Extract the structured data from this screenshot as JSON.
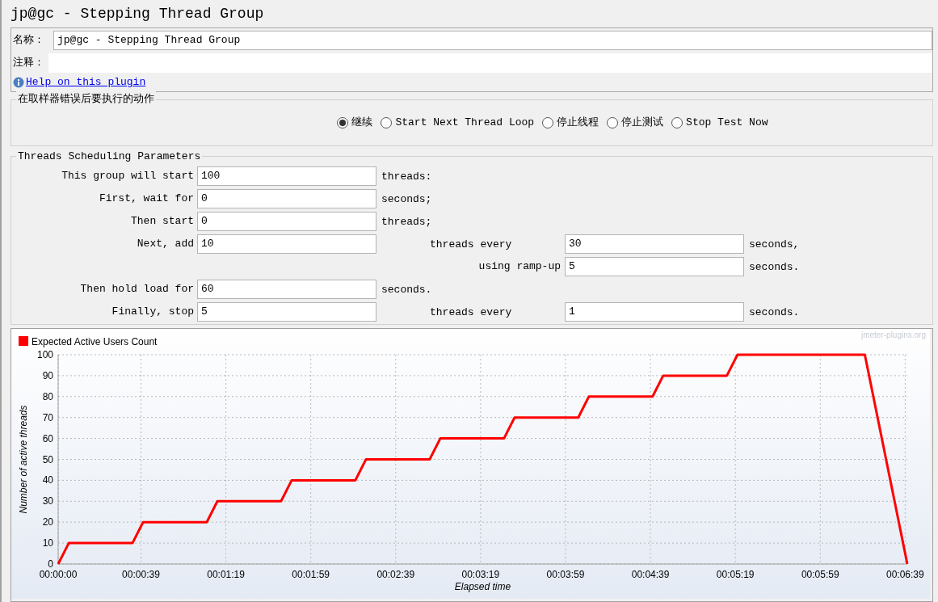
{
  "title": "jp@gc - Stepping Thread Group",
  "name_panel": {
    "name_label": "名称：",
    "name_value": "jp@gc - Stepping Thread Group",
    "comment_label": "注释：",
    "help_link": "Help on this plugin"
  },
  "error_action": {
    "title": "在取样器错误后要执行的动作",
    "options": [
      {
        "label": "继续",
        "selected": true
      },
      {
        "label": "Start Next Thread Loop",
        "selected": false
      },
      {
        "label": "停止线程",
        "selected": false
      },
      {
        "label": "停止测试",
        "selected": false
      },
      {
        "label": "Stop Test Now",
        "selected": false
      }
    ]
  },
  "scheduling": {
    "title": "Threads Scheduling Parameters",
    "rows": [
      {
        "kind": "single",
        "label": "This group will start",
        "value": "100",
        "unit": "threads:"
      },
      {
        "kind": "single",
        "label": "First, wait for",
        "value": "0",
        "unit": "seconds;"
      },
      {
        "kind": "single",
        "label": "Then start",
        "value": "0",
        "unit": "threads;"
      },
      {
        "kind": "dual",
        "label": "Next, add",
        "value": "10",
        "unit": "threads every",
        "value2": "30",
        "unit2": "seconds,"
      },
      {
        "kind": "secondary",
        "label": "using ramp-up",
        "value": "5",
        "unit": "seconds."
      },
      {
        "kind": "single",
        "label": "Then hold load for",
        "value": "60",
        "unit": "seconds."
      },
      {
        "kind": "dual",
        "label": "Finally, stop",
        "value": "5",
        "unit": "threads every",
        "value2": "1",
        "unit2": "seconds."
      }
    ]
  },
  "chart": {
    "credit": "jmeter-plugins.org",
    "chart_data": {
      "type": "line",
      "xlabel": "Elapsed time",
      "ylabel": "Number of active threads",
      "x": [
        0,
        5,
        35,
        40,
        70,
        75,
        105,
        110,
        140,
        145,
        175,
        180,
        210,
        215,
        245,
        250,
        280,
        285,
        315,
        320,
        380,
        381,
        382,
        383,
        384,
        385,
        386,
        387,
        388,
        389,
        390,
        391,
        392,
        393,
        394,
        395,
        396,
        397,
        398,
        399,
        400
      ],
      "series": [
        {
          "name": "Expected Active Users Count",
          "color": "#ff0000",
          "values": [
            0,
            10,
            10,
            20,
            20,
            30,
            30,
            40,
            40,
            50,
            50,
            60,
            60,
            70,
            70,
            80,
            80,
            90,
            90,
            100,
            100,
            95,
            90,
            85,
            80,
            75,
            70,
            65,
            60,
            55,
            50,
            45,
            40,
            35,
            30,
            25,
            20,
            15,
            10,
            5,
            0
          ]
        }
      ],
      "xlim": [
        0,
        400
      ],
      "ylim": [
        0,
        100
      ],
      "xticks": [
        {
          "value": 0,
          "label": "00:00:00"
        },
        {
          "value": 39,
          "label": "00:00:39"
        },
        {
          "value": 79,
          "label": "00:01:19"
        },
        {
          "value": 119,
          "label": "00:01:59"
        },
        {
          "value": 159,
          "label": "00:02:39"
        },
        {
          "value": 199,
          "label": "00:03:19"
        },
        {
          "value": 239,
          "label": "00:03:59"
        },
        {
          "value": 279,
          "label": "00:04:39"
        },
        {
          "value": 319,
          "label": "00:05:19"
        },
        {
          "value": 359,
          "label": "00:05:59"
        },
        {
          "value": 399,
          "label": "00:06:39"
        }
      ],
      "yticks": [
        0,
        10,
        20,
        30,
        40,
        50,
        60,
        70,
        80,
        90,
        100
      ],
      "grid": true
    }
  }
}
